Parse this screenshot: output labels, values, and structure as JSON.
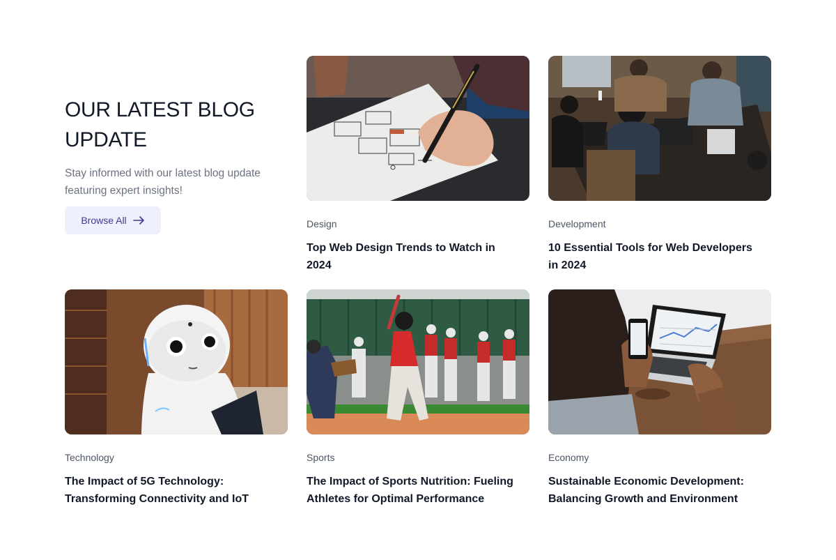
{
  "intro": {
    "heading": "OUR LATEST BLOG UPDATE",
    "description": "Stay informed with our latest blog update featuring expert insights!",
    "browse_label": "Browse All",
    "browse_icon": "arrow-right-icon"
  },
  "posts": [
    {
      "category": "Design",
      "title": "Top Web Design Trends to Watch in 2024",
      "image": "wireframe-sketching-photo"
    },
    {
      "category": "Development",
      "title": "10 Essential Tools for Web Developers in 2024",
      "image": "team-laptops-photo"
    },
    {
      "category": "Technology",
      "title": "The Impact of 5G Technology: Transforming Connectivity and IoT",
      "image": "white-robot-photo"
    },
    {
      "category": "Sports",
      "title": "The Impact of Sports Nutrition: Fueling Athletes for Optimal Performance",
      "image": "baseball-batter-photo"
    },
    {
      "category": "Economy",
      "title": "Sustainable Economic Development: Balancing Growth and Environment",
      "image": "laptop-phone-desk-photo"
    }
  ],
  "colors": {
    "heading": "#111827",
    "muted": "#6b7280",
    "button_bg": "#eef1fd",
    "button_text": "#3e3a92"
  }
}
